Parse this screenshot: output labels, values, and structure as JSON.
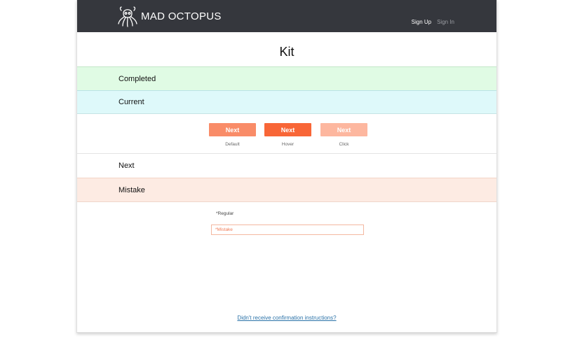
{
  "header": {
    "brand": "MAD OCTOPUS",
    "nav": {
      "sign_up": "Sign Up",
      "sign_in": "Sign In"
    }
  },
  "page": {
    "title": "Kit"
  },
  "states": {
    "completed": "Completed",
    "current": "Current",
    "next": "Next",
    "mistake": "Mistake"
  },
  "buttons": [
    {
      "label": "Next",
      "caption": "Default"
    },
    {
      "label": "Next",
      "caption": "Hover"
    },
    {
      "label": "Next",
      "caption": "Click"
    }
  ],
  "form": {
    "regular_label": "*Regular",
    "mistake_placeholder": "*Mistake"
  },
  "footer": {
    "confirm_link": "Didn't receive confirmation instructions?"
  },
  "colors": {
    "topbar": "#35373d",
    "completed_bg": "#e0fbe4",
    "current_bg": "#def9fa",
    "mistake_bg": "#fdebe3",
    "button_default": "#f98c68",
    "button_hover": "#f86637",
    "button_click": "#fdb79f",
    "link": "#2a72a8"
  },
  "icons": {
    "logo": "octopus-icon"
  }
}
